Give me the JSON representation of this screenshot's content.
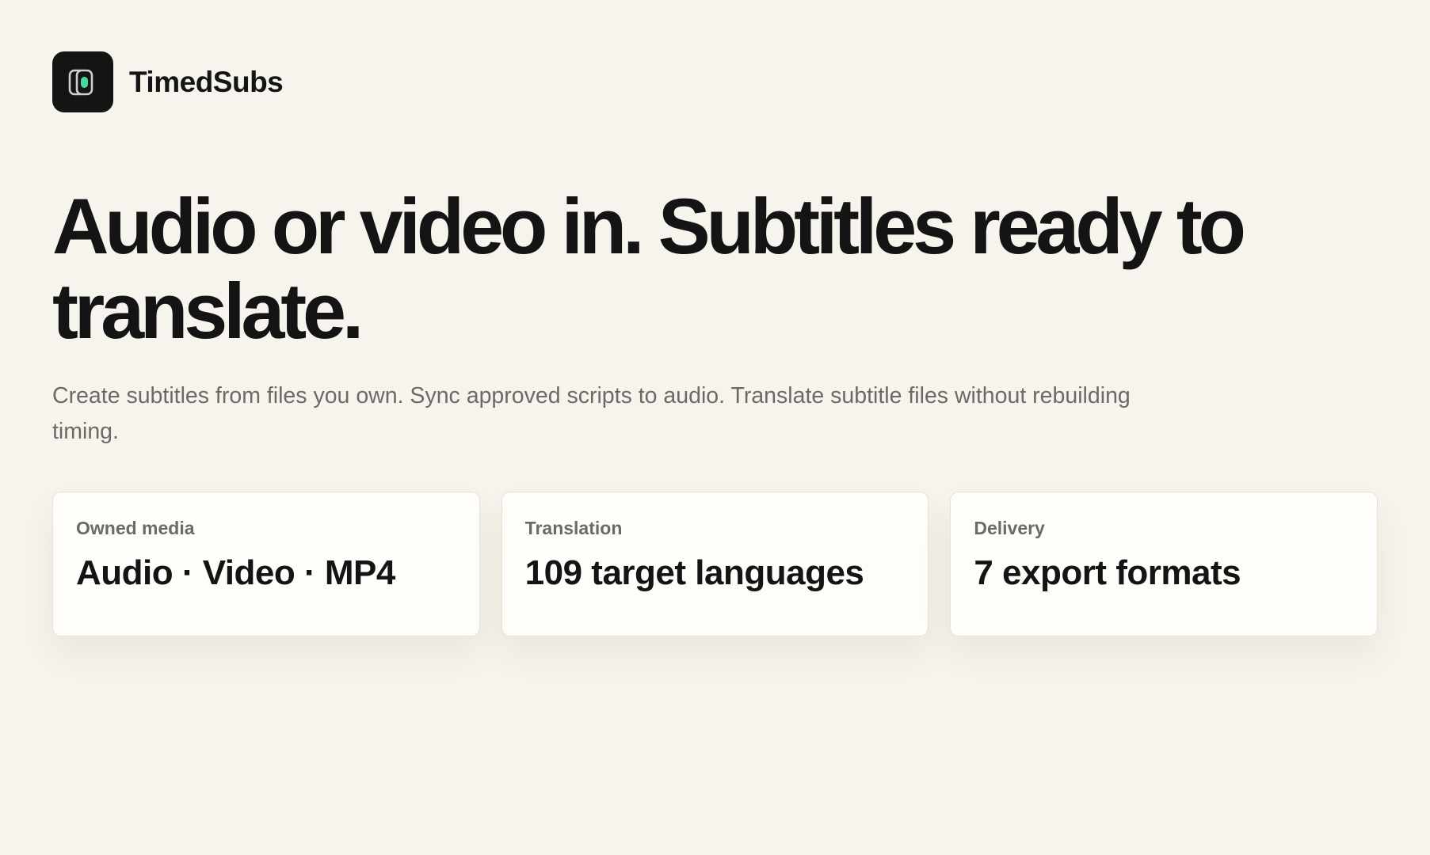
{
  "brand": {
    "name": "TimedSubs",
    "logo_icon": "subtitle-stack-icon",
    "accent_color": "#4ad99a"
  },
  "hero": {
    "title": "Audio or video in. Subtitles ready to translate.",
    "subtitle": "Create subtitles from files you own. Sync approved scripts to audio. Translate subtitle files without rebuilding timing."
  },
  "cards": [
    {
      "label": "Owned media",
      "value": "Audio · Video · MP4"
    },
    {
      "label": "Translation",
      "value": "109 target languages"
    },
    {
      "label": "Delivery",
      "value": "7 export formats"
    }
  ],
  "colors": {
    "background": "#f6f4ec",
    "text": "#141414",
    "muted_text": "#6c6a66",
    "card_background": "#fefdfa",
    "card_border": "#e5e2da"
  }
}
